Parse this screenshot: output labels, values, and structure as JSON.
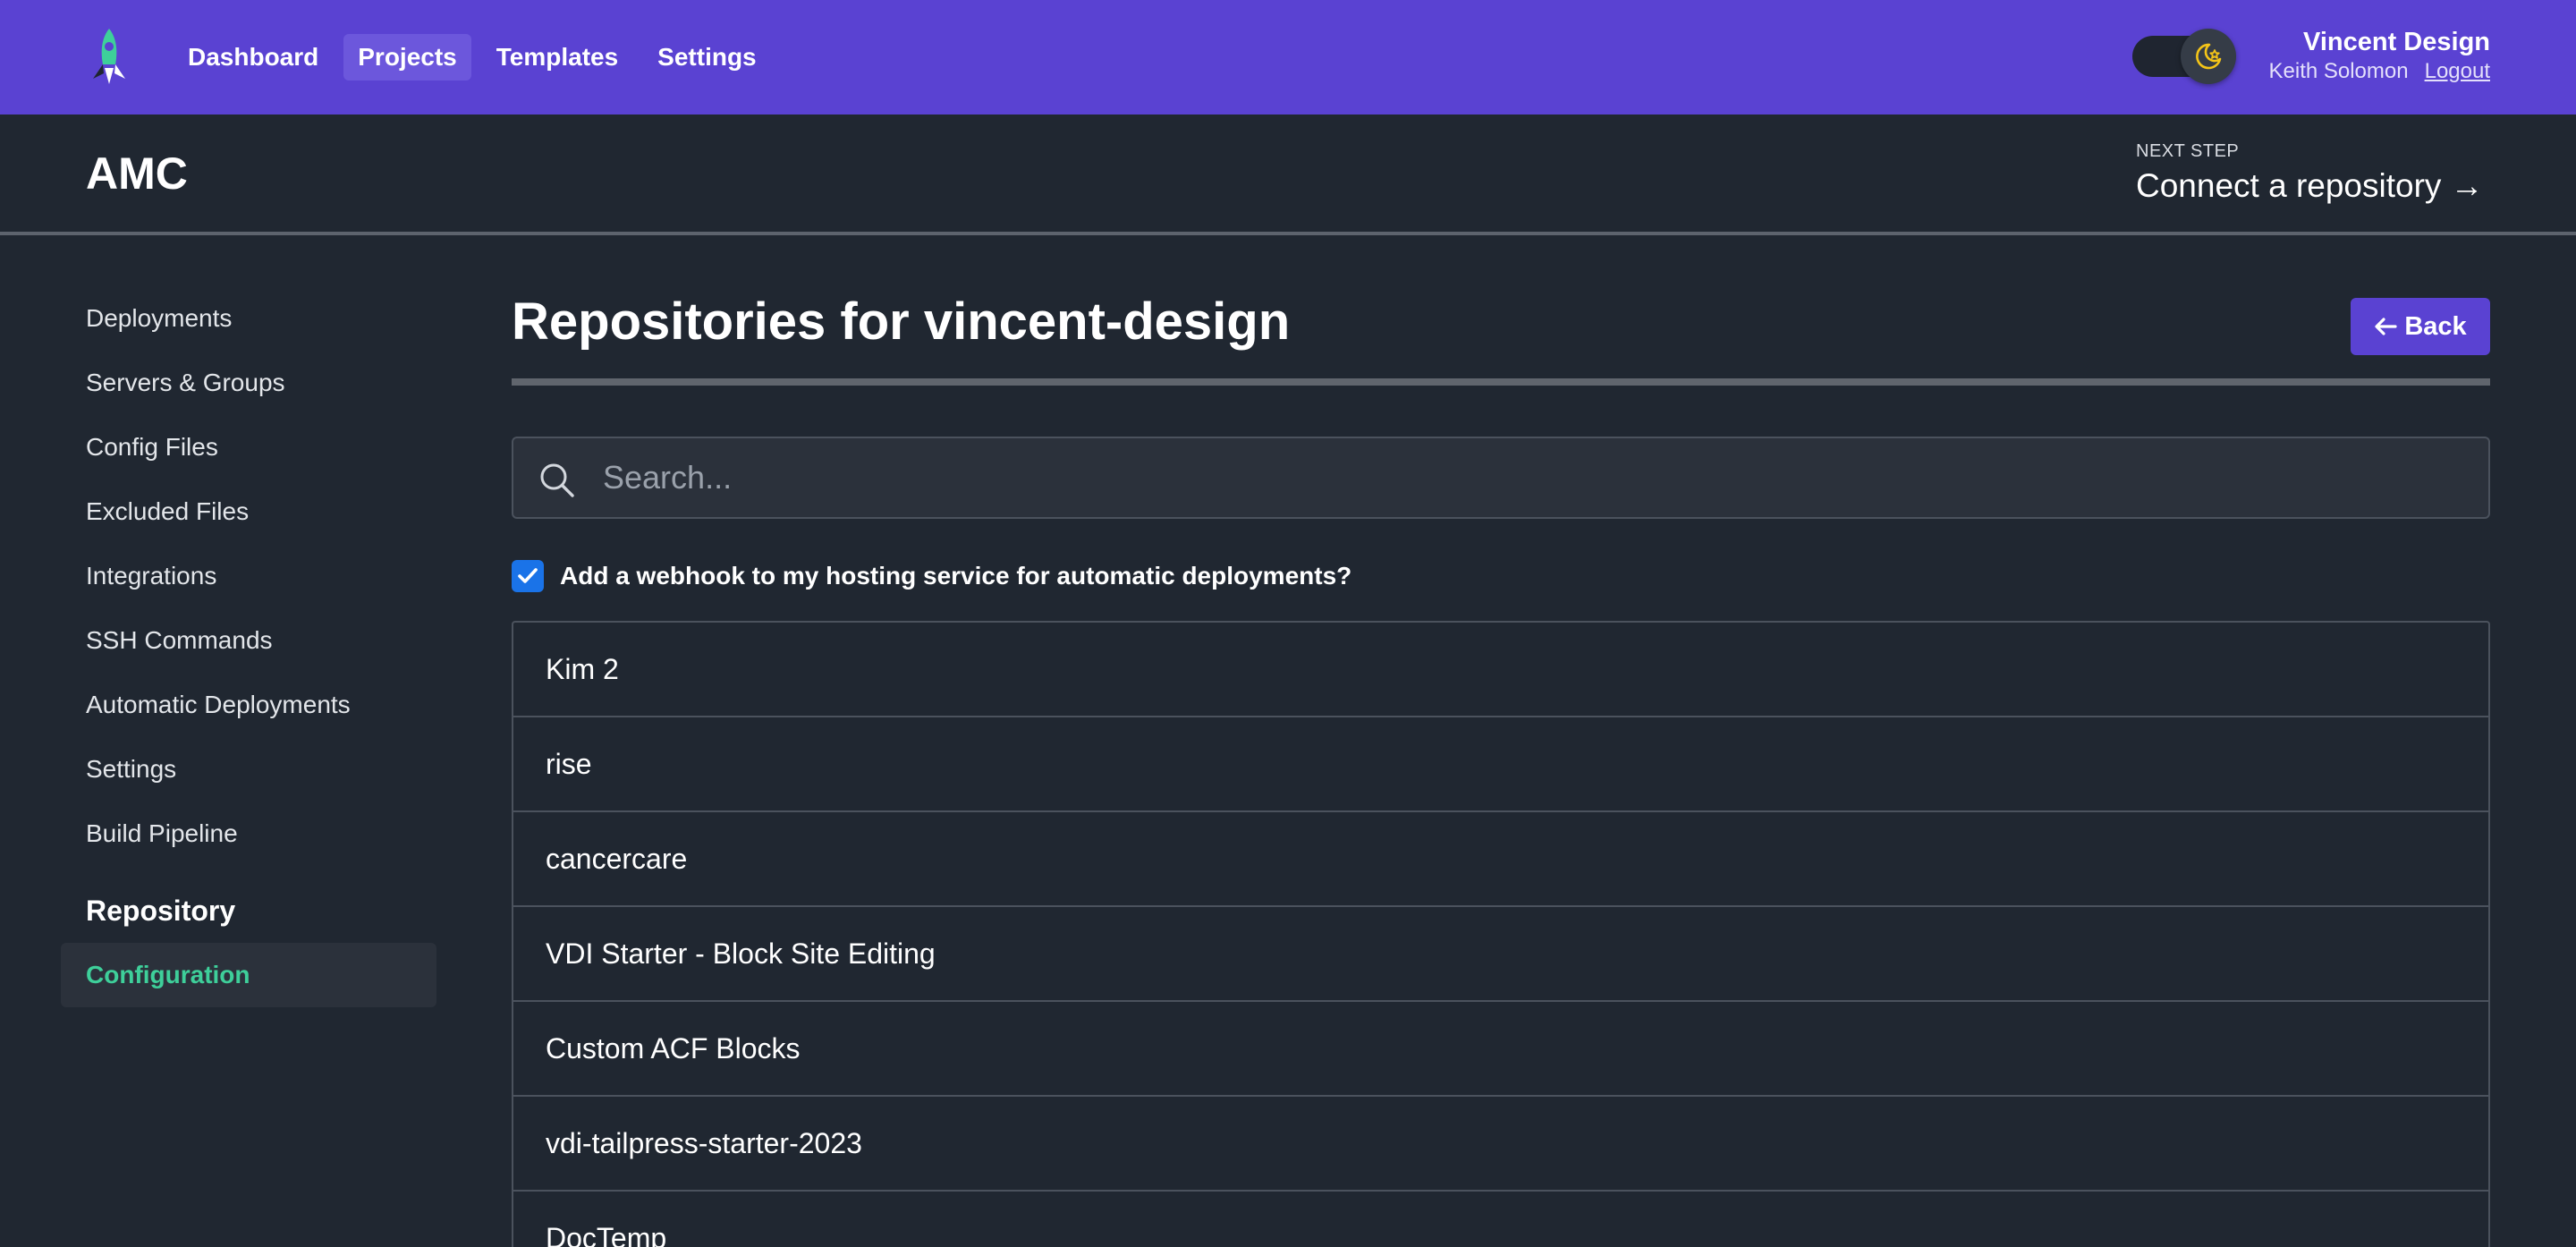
{
  "nav": {
    "items": [
      {
        "label": "Dashboard",
        "active": false
      },
      {
        "label": "Projects",
        "active": true
      },
      {
        "label": "Templates",
        "active": false
      },
      {
        "label": "Settings",
        "active": false
      }
    ],
    "theme_icon": "moon-star-icon",
    "logo_icon": "rocket-logo-icon"
  },
  "account": {
    "team": "Vincent Design",
    "user": "Keith Solomon",
    "logout": "Logout"
  },
  "project": {
    "title": "AMC",
    "next_step_label": "NEXT STEP",
    "next_step_link": "Connect a repository →"
  },
  "sidebar": {
    "items": [
      "Deployments",
      "Servers & Groups",
      "Config Files",
      "Excluded Files",
      "Integrations",
      "SSH Commands",
      "Automatic Deployments",
      "Settings",
      "Build Pipeline"
    ],
    "section_heading": "Repository",
    "current_item": "Configuration"
  },
  "main": {
    "title": "Repositories for vincent-design",
    "back_label": "Back",
    "search_placeholder": "Search...",
    "webhook_label": "Add a webhook to my hosting service for automatic deployments?",
    "webhook_checked": true,
    "repositories": [
      "Kim 2",
      "rise",
      "cancercare",
      "VDI Starter - Block Site Editing",
      "Custom ACF Blocks",
      "vdi-tailpress-starter-2023",
      "DocTemp"
    ]
  },
  "colors": {
    "brand": "#5a42d2",
    "background": "#202731",
    "accent_green": "#3ecf9a",
    "checkbox_blue": "#1a73e8"
  }
}
